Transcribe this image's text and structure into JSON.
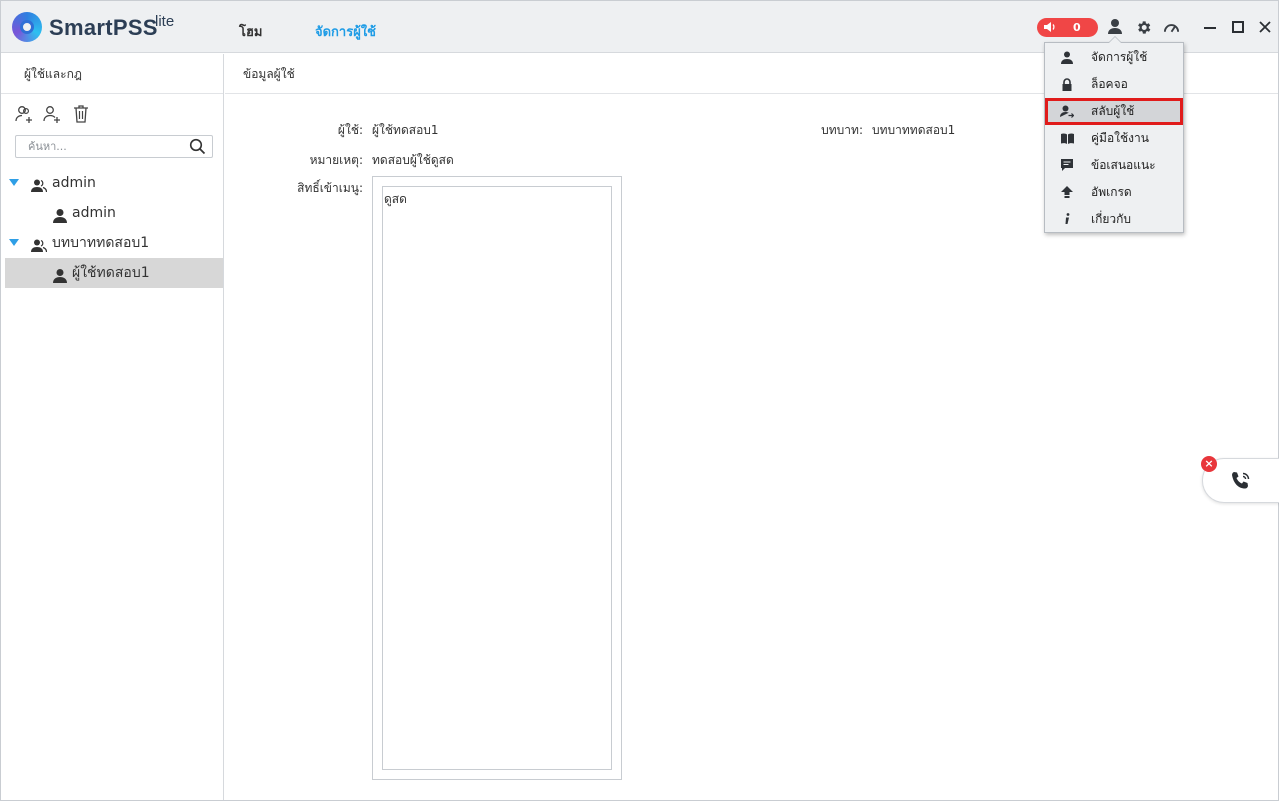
{
  "app": {
    "brand": "SmartPSS",
    "brand_suffix": "lite"
  },
  "nav": {
    "home": "โฮม",
    "user_manage": "จัดการผู้ใช้"
  },
  "alarm": {
    "count": "0"
  },
  "left_panel": {
    "title": "ผู้ใช้และกฎ",
    "search_placeholder": "ค้นหา...",
    "tree": [
      {
        "label": "admin",
        "type": "role"
      },
      {
        "label": "admin",
        "type": "user"
      },
      {
        "label": "บทบาททดสอบ1",
        "type": "role"
      },
      {
        "label": "ผู้ใช้ทดสอบ1",
        "type": "user",
        "selected": true
      }
    ]
  },
  "main": {
    "title": "ข้อมูลผู้ใช้",
    "user_label": "ผู้ใช้:",
    "user_value": "ผู้ใช้ทดสอบ1",
    "role_label": "บทบาท:",
    "role_value": "บทบาททดสอบ1",
    "note_label": "หมายเหตุ:",
    "note_value": "ทดสอบผู้ใช้ดูสด",
    "perm_label": "สิทธิ์เข้าเมนู:",
    "perm_items": [
      "ดูสด"
    ]
  },
  "user_menu": {
    "items": [
      {
        "label": "จัดการผู้ใช้",
        "icon": "user-icon"
      },
      {
        "label": "ล็อคจอ",
        "icon": "lock-icon"
      },
      {
        "label": "สลับผู้ใช้",
        "icon": "switch-user-icon",
        "highlighted": true
      },
      {
        "label": "คู่มือใช้งาน",
        "icon": "book-icon"
      },
      {
        "label": "ข้อเสนอแนะ",
        "icon": "feedback-icon"
      },
      {
        "label": "อัพเกรด",
        "icon": "upgrade-icon"
      },
      {
        "label": "เกี่ยวกับ",
        "icon": "info-icon"
      }
    ]
  },
  "colors": {
    "accent": "#1e9ce6",
    "alarm": "#f04646",
    "highlight_border": "#e01b1b",
    "selected_row": "#d7d7d7"
  }
}
